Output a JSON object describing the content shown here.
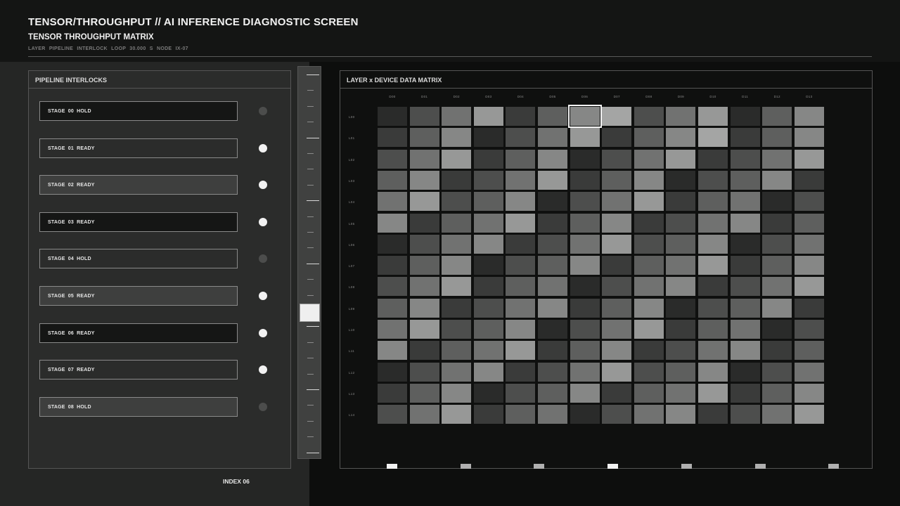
{
  "header": {
    "title": "TENSOR/THROUGHPUT // AI INFERENCE DIAGNOSTIC SCREEN",
    "subtitle": "TENSOR THROUGHPUT MATRIX",
    "meta": "LAYER PIPELINE INTERLOCK   LOOP 30.000 S   NODE IX-07"
  },
  "interlocks": {
    "title": "PIPELINE INTERLOCKS",
    "stages": [
      {
        "label": "STAGE 00  HOLD",
        "state": "hold",
        "tone": "dark"
      },
      {
        "label": "STAGE 01  READY",
        "state": "ready",
        "tone": "mid"
      },
      {
        "label": "STAGE 02  READY",
        "state": "ready",
        "tone": "light"
      },
      {
        "label": "STAGE 03  READY",
        "state": "ready",
        "tone": "dark"
      },
      {
        "label": "STAGE 04  HOLD",
        "state": "hold",
        "tone": "mid"
      },
      {
        "label": "STAGE 05  READY",
        "state": "ready",
        "tone": "light"
      },
      {
        "label": "STAGE 06  READY",
        "state": "ready",
        "tone": "dark"
      },
      {
        "label": "STAGE 07  READY",
        "state": "ready",
        "tone": "mid"
      },
      {
        "label": "STAGE 08  HOLD",
        "state": "hold",
        "tone": "light"
      }
    ]
  },
  "slider": {
    "index_label": "INDEX 06",
    "position_fraction": 0.62
  },
  "matrix": {
    "title": "LAYER x DEVICE DATA MATRIX",
    "columns": [
      "D00",
      "D01",
      "D02",
      "D03",
      "D04",
      "D05",
      "D06",
      "D07",
      "D08",
      "D09",
      "D10",
      "D11",
      "D12",
      "D13"
    ],
    "rows": [
      "L00",
      "L01",
      "L02",
      "L03",
      "L04",
      "L05",
      "L06",
      "L07",
      "L08",
      "L09",
      "L10",
      "L11",
      "L12",
      "L13",
      "L14"
    ],
    "selected": {
      "row": "L00",
      "col": "D06"
    },
    "levels": [
      [
        1,
        3,
        5,
        7,
        2,
        4,
        6,
        8,
        3,
        5,
        7,
        1,
        4,
        6
      ],
      [
        2,
        4,
        6,
        1,
        3,
        5,
        7,
        2,
        4,
        6,
        8,
        2,
        4,
        6
      ],
      [
        3,
        5,
        7,
        2,
        4,
        6,
        1,
        3,
        5,
        7,
        2,
        3,
        5,
        7
      ],
      [
        4,
        6,
        2,
        3,
        5,
        7,
        2,
        4,
        6,
        1,
        3,
        4,
        6,
        2
      ],
      [
        5,
        7,
        3,
        4,
        6,
        1,
        3,
        5,
        7,
        2,
        4,
        5,
        1,
        3
      ],
      [
        6,
        2,
        4,
        5,
        7,
        2,
        4,
        6,
        2,
        3,
        5,
        6,
        2,
        4
      ],
      [
        1,
        3,
        5,
        6,
        2,
        3,
        5,
        7,
        3,
        4,
        6,
        1,
        3,
        5
      ],
      [
        2,
        4,
        6,
        1,
        3,
        4,
        6,
        2,
        4,
        5,
        7,
        2,
        4,
        6
      ],
      [
        3,
        5,
        7,
        2,
        4,
        5,
        1,
        3,
        5,
        6,
        2,
        3,
        5,
        7
      ],
      [
        4,
        6,
        2,
        3,
        5,
        6,
        2,
        4,
        6,
        1,
        3,
        4,
        6,
        2
      ],
      [
        5,
        7,
        3,
        4,
        6,
        1,
        3,
        5,
        7,
        2,
        4,
        5,
        1,
        3
      ],
      [
        6,
        2,
        4,
        5,
        7,
        2,
        4,
        6,
        2,
        3,
        5,
        6,
        2,
        4
      ],
      [
        1,
        3,
        5,
        6,
        2,
        3,
        5,
        7,
        3,
        4,
        6,
        1,
        3,
        5
      ],
      [
        2,
        4,
        6,
        1,
        3,
        4,
        6,
        2,
        4,
        5,
        7,
        2,
        4,
        6
      ],
      [
        3,
        5,
        7,
        2,
        4,
        5,
        1,
        3,
        5,
        6,
        2,
        3,
        5,
        7
      ]
    ],
    "palette": [
      "#1a1b1a",
      "#2a2b2a",
      "#3a3b3a",
      "#4d4e4d",
      "#5e5f5e",
      "#717271",
      "#868786",
      "#979897",
      "#a4a5a4"
    ],
    "markers": [
      "bright",
      "dim",
      "dim",
      "bright",
      "dim",
      "dim",
      "dim"
    ]
  },
  "colors": {
    "led_on": "#f2f2f2",
    "led_off": "#4c4d4c",
    "marker_bright": "#f2f2f2",
    "marker_dim": "#b0b0b0"
  }
}
